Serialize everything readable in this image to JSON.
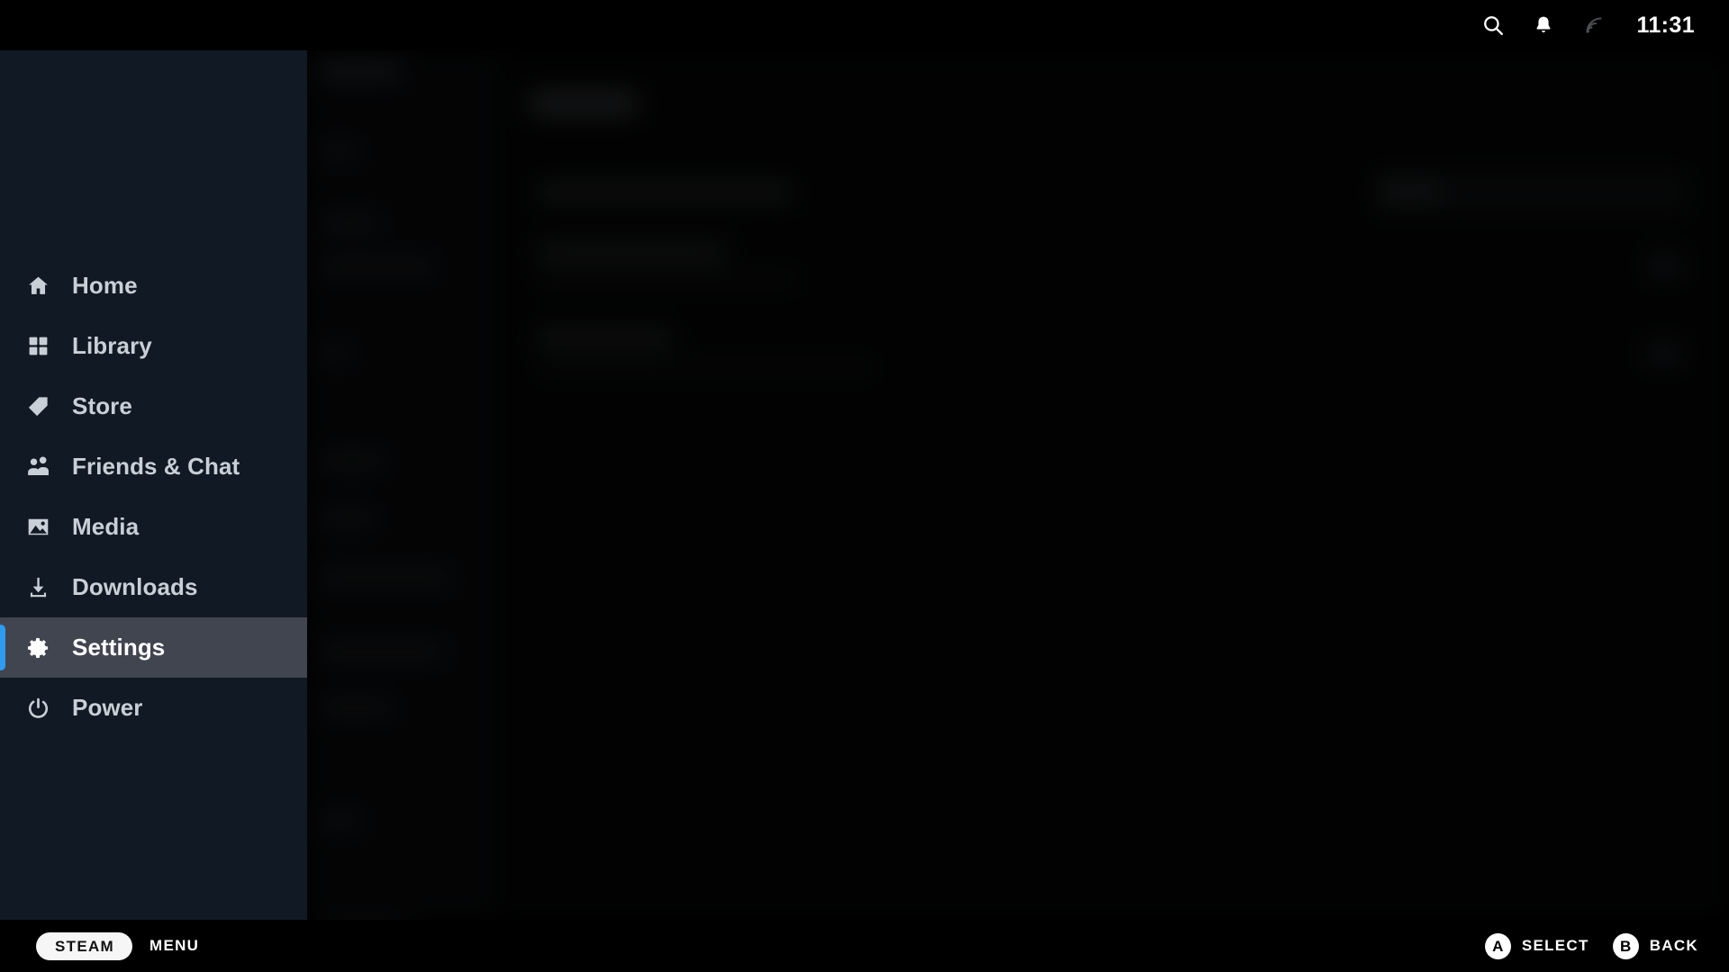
{
  "topbar": {
    "search_icon": "search-icon",
    "notifications_icon": "bell-icon",
    "network_icon": "wifi-icon",
    "time": "11:31"
  },
  "sidebar": {
    "accent_color": "#2e9bf0",
    "active_bg": "#414550",
    "background": "#111924",
    "items": [
      {
        "label": "Home",
        "icon": "home-icon",
        "active": false
      },
      {
        "label": "Library",
        "icon": "grid-icon",
        "active": false
      },
      {
        "label": "Store",
        "icon": "tag-icon",
        "active": false
      },
      {
        "label": "Friends & Chat",
        "icon": "people-icon",
        "active": false
      },
      {
        "label": "Media",
        "icon": "image-icon",
        "active": false
      },
      {
        "label": "Downloads",
        "icon": "download-icon",
        "active": false
      },
      {
        "label": "Settings",
        "icon": "gear-icon",
        "active": true
      },
      {
        "label": "Power",
        "icon": "power-icon",
        "active": false
      }
    ]
  },
  "background": {
    "note": "blurred settings screen behind the overlay menu"
  },
  "bottombar": {
    "steam_label": "STEAM",
    "menu_label": "MENU",
    "hints": [
      {
        "button": "A",
        "label": "SELECT"
      },
      {
        "button": "B",
        "label": "BACK"
      }
    ]
  }
}
